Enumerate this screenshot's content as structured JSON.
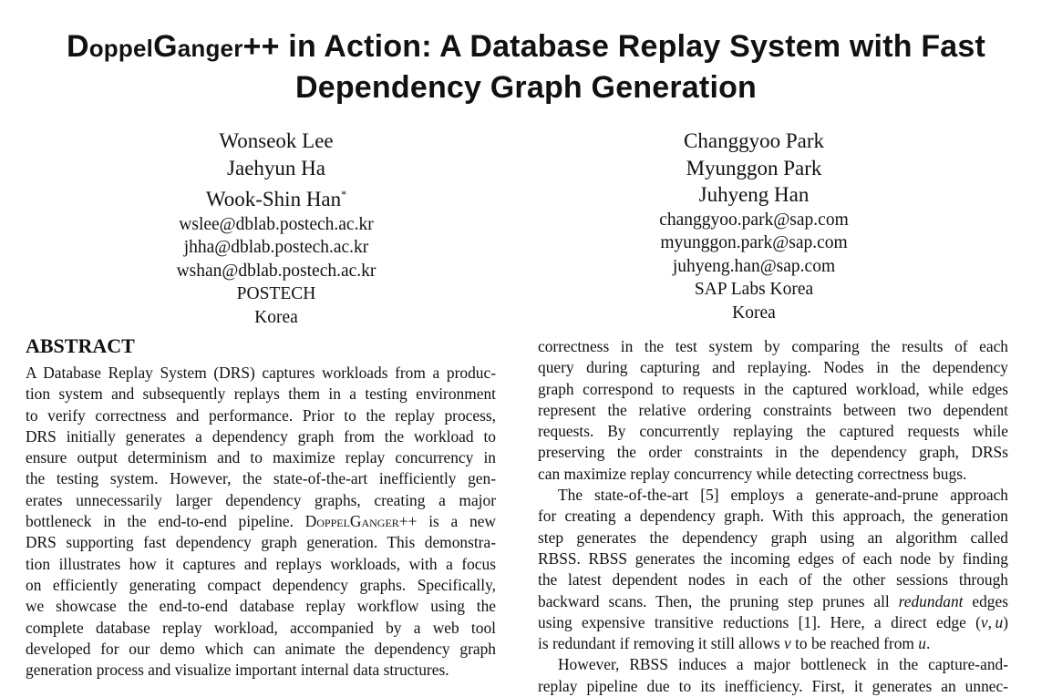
{
  "title": {
    "name_part1_cap": "D",
    "name_part1_rest": "oppel",
    "name_part2_cap": "G",
    "name_part2_rest": "anger",
    "name_suffix": "++",
    "line1_rest": " in Action: A Database Replay System with Fast",
    "line2": "Dependency Graph Generation"
  },
  "authors_left": {
    "names": [
      "Wonseok Lee",
      "Jaehyun Ha",
      "Wook-Shin Han"
    ],
    "corresponding_mark": "*",
    "emails": [
      "wslee@dblab.postech.ac.kr",
      "jhha@dblab.postech.ac.kr",
      "wshan@dblab.postech.ac.kr"
    ],
    "affiliation": "POSTECH",
    "country": "Korea"
  },
  "authors_right": {
    "names": [
      "Changgyoo Park",
      "Myunggon Park",
      "Juhyeng Han"
    ],
    "emails": [
      "changgyoo.park@sap.com",
      "myunggon.park@sap.com",
      "juhyeng.han@sap.com"
    ],
    "affiliation": "SAP Labs Korea",
    "country": "Korea"
  },
  "abstract": {
    "heading": "ABSTRACT",
    "lines": [
      "A Database Replay System (DRS) captures workloads from a produc-",
      "tion system and subsequently replays them in a testing environment",
      "to verify correctness and performance. Prior to the replay process,",
      "DRS initially generates a dependency graph from the workload to",
      "ensure output determinism and to maximize replay concurrency in",
      "the testing system. However, the state-of-the-art inefficiently gen-",
      "erates unnecessarily larger dependency graphs, creating a major",
      "bottleneck in the end-to-end pipeline. DoppelGanger++ is a new",
      "DRS supporting fast dependency graph generation. This demonstra-",
      "tion illustrates how it captures and replays workloads, with a focus",
      "on efficiently generating compact dependency graphs. Specifically,",
      "we showcase the end-to-end database replay workflow using the",
      "complete database replay workload, accompanied by a web tool",
      "developed for our demo which can animate the dependency graph",
      "generation process and visualize important internal data structures."
    ]
  },
  "right_column": {
    "para1": [
      "correctness in the test system by comparing the results of each",
      "query during capturing and replaying. Nodes in the dependency",
      "graph correspond to requests in the captured workload, while edges",
      "represent the relative ordering constraints between two dependent",
      "requests. By concurrently replaying the captured requests while",
      "preserving the order constraints in the dependency graph, DRSs",
      "can maximize replay concurrency while detecting correctness bugs."
    ],
    "para2": [
      "The state-of-the-art [5] employs a generate-and-prune approach",
      "for creating a dependency graph. With this approach, the generation",
      "step generates the dependency graph using an algorithm called",
      "RBSS. RBSS generates the incoming edges of each node by finding",
      "the latest dependent nodes in each of the other sessions through",
      "backward scans. Then, the pruning step prunes all redundant edges",
      "using expensive transitive reductions [1]. Here, a direct edge (v, u)",
      "is redundant if removing it still allows v to be reached from u."
    ],
    "para3": [
      "However, RBSS induces a major bottleneck in the capture-and-",
      "replay pipeline due to its inefficiency. First, it generates an unnec-"
    ]
  }
}
